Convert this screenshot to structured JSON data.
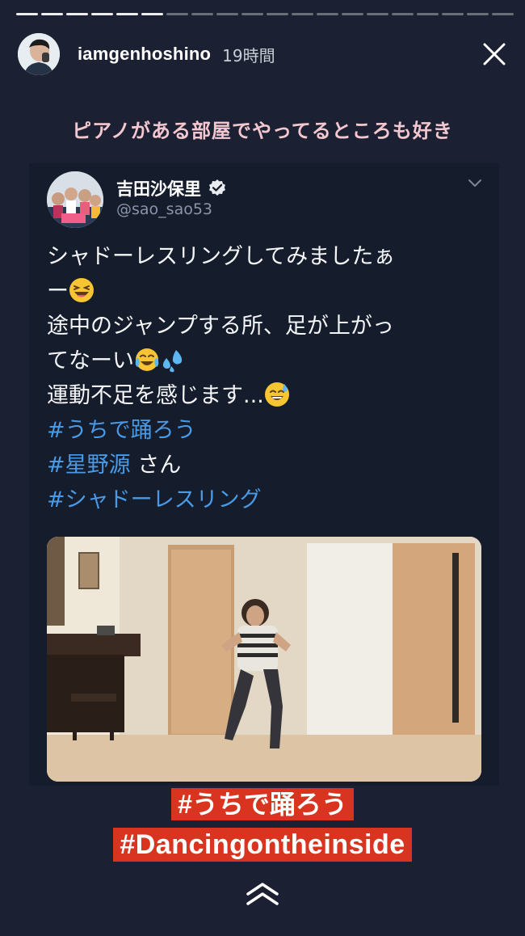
{
  "story": {
    "progress_segments": 20,
    "progress_completed": 6,
    "username": "iamgenhoshino",
    "time_ago": "19時間",
    "caption": "ピアノがある部屋でやってるところも好き"
  },
  "tweet": {
    "display_name": "吉田沙保里",
    "handle": "@sao_sao53",
    "lines": [
      "シャドーレスリングしてみましたぁ",
      "ー",
      "途中のジャンプする所、足が上がっ",
      "てなーい",
      "運動不足を感じます..."
    ],
    "hashtags": [
      "#うちで踊ろう",
      "#星野源",
      "#シャドーレスリング"
    ],
    "mention_suffix": " さん"
  },
  "stickers": {
    "line1": "#うちで踊ろう",
    "line2": "#Dancingontheinside"
  },
  "icons": [
    "close-icon",
    "verified-badge-icon",
    "chevron-down-icon",
    "swipe-up-icon",
    "laughing-emoji",
    "tears-of-joy-emoji",
    "sweat-droplets-emoji",
    "grinning-sweat-emoji"
  ],
  "colors": {
    "background": "#1b2132",
    "caption": "#f3c7cf",
    "hashtag": "#4a9ae6",
    "sticker": "#d9341f"
  }
}
